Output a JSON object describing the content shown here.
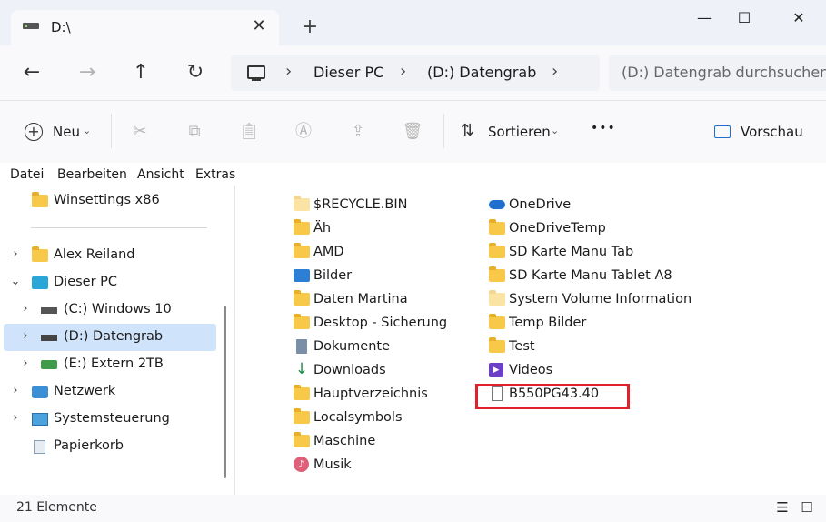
{
  "window": {
    "tab_title": "D:\\",
    "new_tab": "+",
    "minimize": "—",
    "maximize": "☐",
    "close": "✕"
  },
  "nav": {
    "back": "←",
    "forward": "→",
    "up": "↑",
    "refresh": "↻",
    "breadcrumb": [
      "Dieser PC",
      "(D:) Datengrab"
    ],
    "search_placeholder": "(D:) Datengrab durchsuchen"
  },
  "toolbar": {
    "new_label": "Neu",
    "sort_label": "Sortieren",
    "more": "•••",
    "preview_label": "Vorschau"
  },
  "menubar": [
    "Datei",
    "Bearbeiten",
    "Ansicht",
    "Extras"
  ],
  "sidebar": {
    "items": [
      {
        "label": "Winsettings x86",
        "icon": "folder-icon"
      },
      {
        "label": "Alex Reiland",
        "icon": "folder-icon"
      },
      {
        "label": "Dieser PC",
        "icon": "monitor-icon"
      },
      {
        "label": "(C:) Windows 10",
        "icon": "windows-drive-icon"
      },
      {
        "label": "(D:) Datengrab",
        "icon": "drive-icon"
      },
      {
        "label": "(E:) Extern 2TB",
        "icon": "external-drive-icon"
      },
      {
        "label": "Netzwerk",
        "icon": "network-icon"
      },
      {
        "label": "Systemsteuerung",
        "icon": "control-panel-icon"
      },
      {
        "label": "Papierkorb",
        "icon": "recycle-bin-icon"
      }
    ]
  },
  "files": {
    "col1": [
      {
        "name": "$RECYCLE.BIN",
        "icon": "folder-faded-icon"
      },
      {
        "name": "Äh",
        "icon": "folder-icon"
      },
      {
        "name": "AMD",
        "icon": "folder-icon"
      },
      {
        "name": "Bilder",
        "icon": "pictures-icon"
      },
      {
        "name": "Daten Martina",
        "icon": "folder-icon"
      },
      {
        "name": "Desktop - Sicherung",
        "icon": "folder-icon"
      },
      {
        "name": "Dokumente",
        "icon": "documents-icon"
      },
      {
        "name": "Downloads",
        "icon": "downloads-icon"
      },
      {
        "name": "Hauptverzeichnis",
        "icon": "folder-icon"
      },
      {
        "name": "Localsymbols",
        "icon": "folder-icon"
      },
      {
        "name": "Maschine",
        "icon": "folder-icon"
      },
      {
        "name": "Musik",
        "icon": "music-icon"
      }
    ],
    "col2": [
      {
        "name": "OneDrive",
        "icon": "onedrive-icon"
      },
      {
        "name": "OneDriveTemp",
        "icon": "folder-icon"
      },
      {
        "name": "SD Karte Manu Tab",
        "icon": "folder-icon"
      },
      {
        "name": "SD Karte Manu Tablet A8",
        "icon": "folder-icon"
      },
      {
        "name": "System Volume Information",
        "icon": "folder-faded-icon"
      },
      {
        "name": "Temp Bilder",
        "icon": "folder-icon"
      },
      {
        "name": "Test",
        "icon": "folder-icon"
      },
      {
        "name": "Videos",
        "icon": "videos-icon"
      },
      {
        "name": "B550PG43.40",
        "icon": "file-icon"
      }
    ]
  },
  "status": {
    "count": "21 Elemente"
  },
  "colors": {
    "accent_selection": "#cfe4fa",
    "highlight_box": "#e0202a",
    "folder": "#f8c849"
  }
}
